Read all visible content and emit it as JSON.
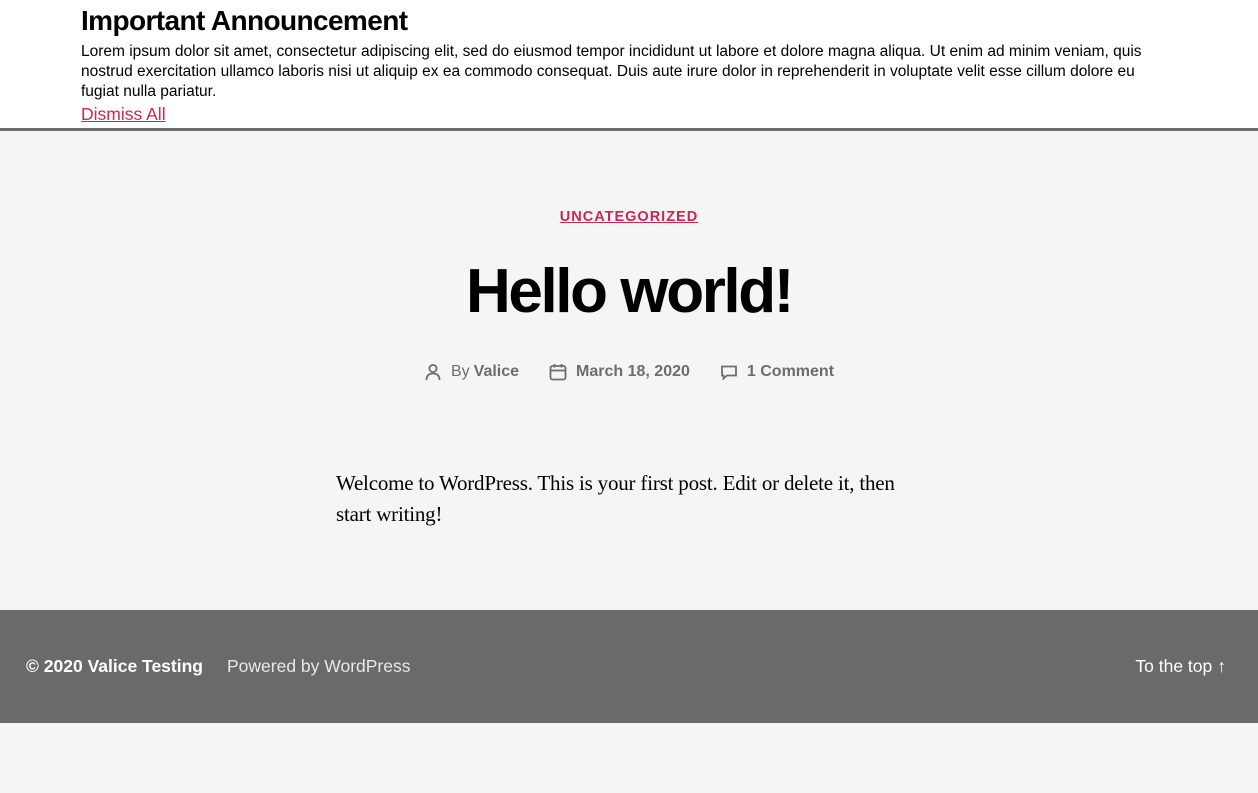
{
  "announcement": {
    "title": "Important Announcement",
    "text": "Lorem ipsum dolor sit amet, consectetur adipiscing elit, sed do eiusmod tempor incididunt ut labore et dolore magna aliqua. Ut enim ad minim veniam, quis nostrud exercitation ullamco laboris nisi ut aliquip ex ea commodo consequat. Duis aute irure dolor in reprehenderit in voluptate velit esse cillum dolore eu fugiat nulla pariatur.",
    "dismiss_label": "Dismiss All"
  },
  "post": {
    "category": "Uncategorized",
    "title": "Hello world!",
    "author_prefix": "By",
    "author": "Valice",
    "date": "March 18, 2020",
    "comments": "1 Comment",
    "body": "Welcome to WordPress. This is your first post. Edit or delete it, then start writing!"
  },
  "footer": {
    "copyright": "© 2020",
    "site_name": "Valice Testing",
    "powered": "Powered by WordPress",
    "to_top": "To the top",
    "to_top_arrow": "↑"
  },
  "colors": {
    "accent": "#cd2653",
    "footer_bg": "#6a6a6a",
    "page_bg": "#f5f5f5"
  }
}
